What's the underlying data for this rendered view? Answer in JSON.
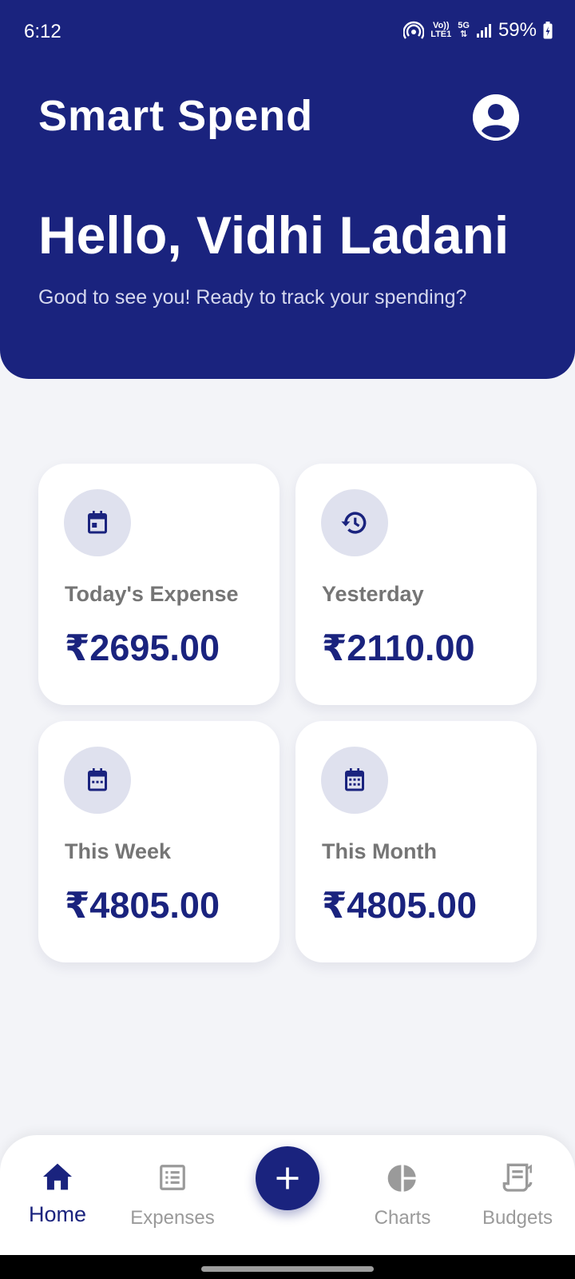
{
  "status_bar": {
    "time": "6:12",
    "volte": "Vo))",
    "lte": "LTE1",
    "network": "5G",
    "battery": "59%"
  },
  "header": {
    "app_title": "Smart Spend",
    "greeting": "Hello, Vidhi Ladani",
    "subtext": "Good to see you! Ready to track your spending?"
  },
  "cards": [
    {
      "label": "Today's Expense",
      "value": "₹2695.00",
      "icon": "calendar-today-icon"
    },
    {
      "label": "Yesterday",
      "value": "₹2110.00",
      "icon": "history-icon"
    },
    {
      "label": "This Week",
      "value": "₹4805.00",
      "icon": "calendar-week-icon"
    },
    {
      "label": "This Month",
      "value": "₹4805.00",
      "icon": "calendar-month-icon"
    }
  ],
  "nav": {
    "items": [
      {
        "label": "Home",
        "icon": "home-icon",
        "active": true
      },
      {
        "label": "Expenses",
        "icon": "list-icon",
        "active": false
      },
      {
        "label": "Charts",
        "icon": "pie-chart-icon",
        "active": false
      },
      {
        "label": "Budgets",
        "icon": "receipt-icon",
        "active": false
      }
    ],
    "fab_icon": "plus-icon"
  },
  "colors": {
    "primary": "#1a237e",
    "background": "#f3f4f8",
    "card": "#ffffff",
    "label_gray": "#757575",
    "icon_circle": "#dfe1ee"
  }
}
